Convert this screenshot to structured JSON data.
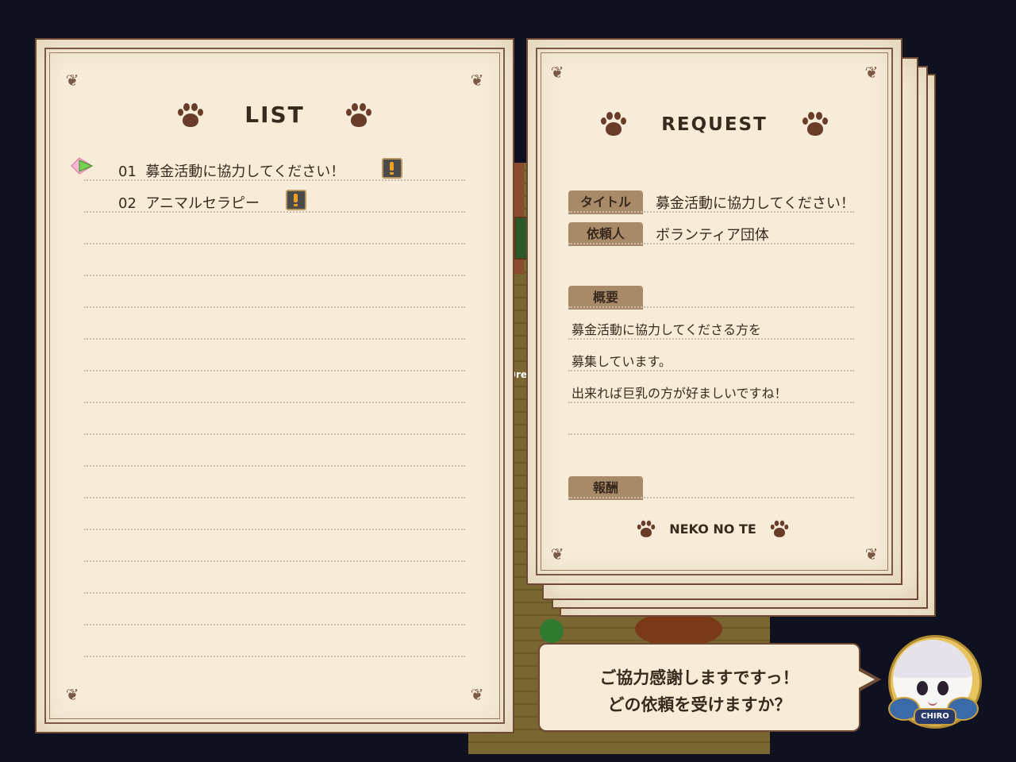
{
  "list_panel": {
    "heading": "LIST",
    "items": [
      {
        "number": "01",
        "title": "募金活動に協力してください！",
        "new_badge": "exclamation-icon"
      },
      {
        "number": "02",
        "title": "アニマルセラピー",
        "new_badge": "exclamation-icon"
      }
    ],
    "selected_index": 0
  },
  "request_panel": {
    "heading": "REQUEST",
    "title_label": "タイトル",
    "title_value": "募金活動に協力してください！",
    "client_label": "依頼人",
    "client_value": "ボランティア団体",
    "summary_label": "概要",
    "summary_lines": [
      "募金活動に協力してくださる方を",
      "募集しています。",
      "出来れば巨乳の方が好ましいですね！"
    ],
    "reward_label": "報酬",
    "footer": "NEKO NO TE"
  },
  "dialog": {
    "lines": [
      "ご協力感謝しますですっ！",
      "どの依頼を受けますか？"
    ],
    "speaker_badge": "CHIRO"
  },
  "background": {
    "sign_text": "Dre"
  },
  "colors": {
    "paper": "#f6ecd8",
    "ink": "#3a2a1e",
    "frame": "#6d4a34",
    "label_tab": "#a88a68",
    "background": "#0f1020"
  }
}
